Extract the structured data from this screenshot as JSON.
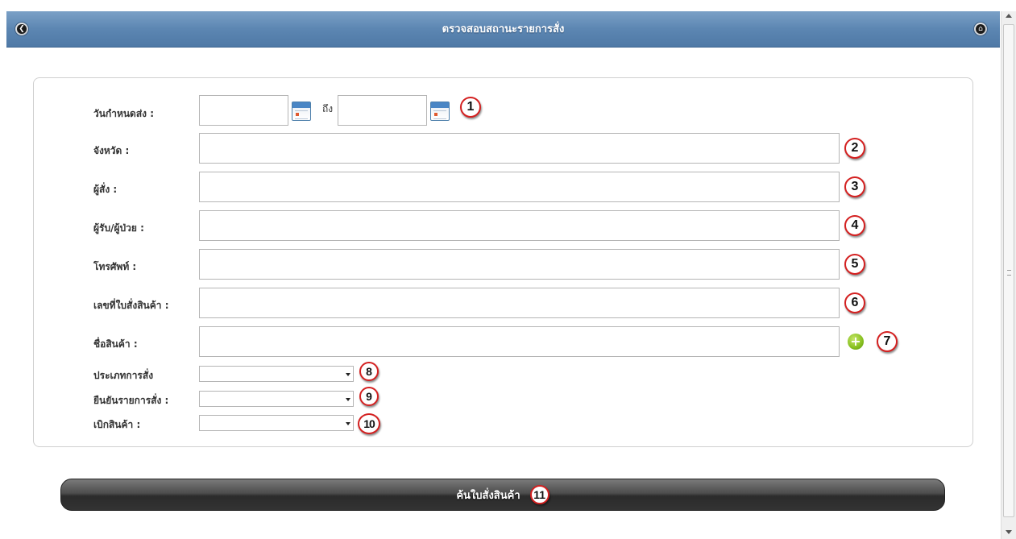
{
  "header": {
    "title": "ตรวจสอบสถานะรายการสั่ง",
    "back_icon": "chevron-left-icon",
    "home_icon": "home-icon"
  },
  "form": {
    "delivery_date": {
      "label": "วันกำหนดส่ง :",
      "from_value": "",
      "to_label": "ถึง",
      "to_value": "",
      "marker": "1"
    },
    "province": {
      "label": "จังหวัด :",
      "value": "",
      "marker": "2"
    },
    "orderer": {
      "label": "ผู้สั่ง :",
      "value": "",
      "marker": "3"
    },
    "recipient": {
      "label": "ผู้รับ/ผู้ป่วย :",
      "value": "",
      "marker": "4"
    },
    "phone": {
      "label": "โทรศัพท์ :",
      "value": "",
      "marker": "5"
    },
    "order_number": {
      "label": "เลขที่ใบสั่งสินค้า :",
      "value": "",
      "marker": "6"
    },
    "product_name": {
      "label": "ชื่อสินค้า :",
      "value": "",
      "marker": "7",
      "add_icon": "plus-circle-icon"
    },
    "order_type": {
      "label": "ประเภทการสั่ง",
      "selected": "",
      "marker": "8"
    },
    "order_confirm": {
      "label": "ยืนยันรายการสั่ง :",
      "selected": "",
      "marker": "9"
    },
    "withdraw": {
      "label": "เบิกสินค้า :",
      "selected": "",
      "marker": "10"
    }
  },
  "search_button": {
    "label": "ค้นใบสั่งสินค้า",
    "marker": "11"
  },
  "colors": {
    "header_bg": "#5c86b2",
    "marker_border": "#d42020",
    "button_bg": "#333333",
    "add_icon": "#86bf1f"
  }
}
